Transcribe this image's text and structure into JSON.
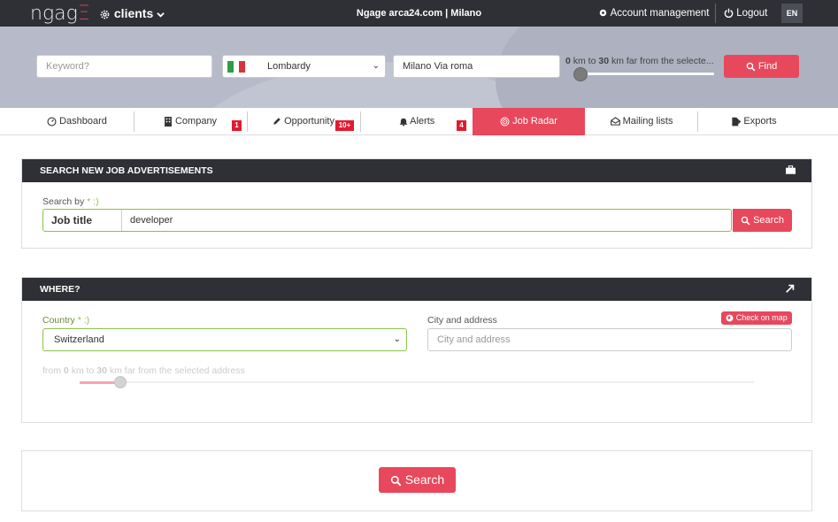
{
  "topbar": {
    "logo_main": "ngag",
    "logo_end": "Ξ",
    "clients_label": "clients",
    "center_title": "Ngage arca24.com | Milano",
    "account_label": "Account management",
    "logout_label": "Logout",
    "lang_label": "EN"
  },
  "hero": {
    "keyword_placeholder": "Keyword?",
    "region_value": "Lombardy",
    "address_value": "Milano Via roma",
    "range_from": "0",
    "range_to": "30",
    "range_text_1": "km to",
    "range_text_2": "km far from the selecte...",
    "find_label": "Find",
    "range_fraction": 0
  },
  "tabs": [
    {
      "label": "Dashboard",
      "icon": "dashboard-icon"
    },
    {
      "label": "Company",
      "icon": "building-icon",
      "badge": "1"
    },
    {
      "label": "Opportunity",
      "icon": "pencil-icon",
      "badge": "10+"
    },
    {
      "label": "Alerts",
      "icon": "bell-icon",
      "badge": "4"
    },
    {
      "label": "Job Radar",
      "icon": "radar-icon",
      "active": true
    },
    {
      "label": "Mailing lists",
      "icon": "envelope-icon"
    },
    {
      "label": "Exports",
      "icon": "export-icon"
    }
  ],
  "search_panel": {
    "header": "SEARCH NEW JOB ADVERTISEMENTS",
    "search_by_label": "Search by",
    "req_mark": "* :)",
    "field_label": "Job title",
    "field_value": "developer",
    "search_label": "Search"
  },
  "where_panel": {
    "header": "WHERE?",
    "country_label": "Country",
    "req_mark": "* :)",
    "country_value": "Switzerland",
    "city_label": "City and address",
    "city_placeholder": "City and address",
    "check_map_label": "Check on map",
    "range_prefix": "from",
    "range_from": "0",
    "range_mid": "km to",
    "range_to": "30",
    "range_suffix": "km far from the selected address",
    "range_fraction": 0.06
  },
  "footer": {
    "search_label": "Search"
  },
  "colors": {
    "accent": "#e8485c",
    "dark": "#2e3035",
    "valid": "#8bc34a"
  }
}
